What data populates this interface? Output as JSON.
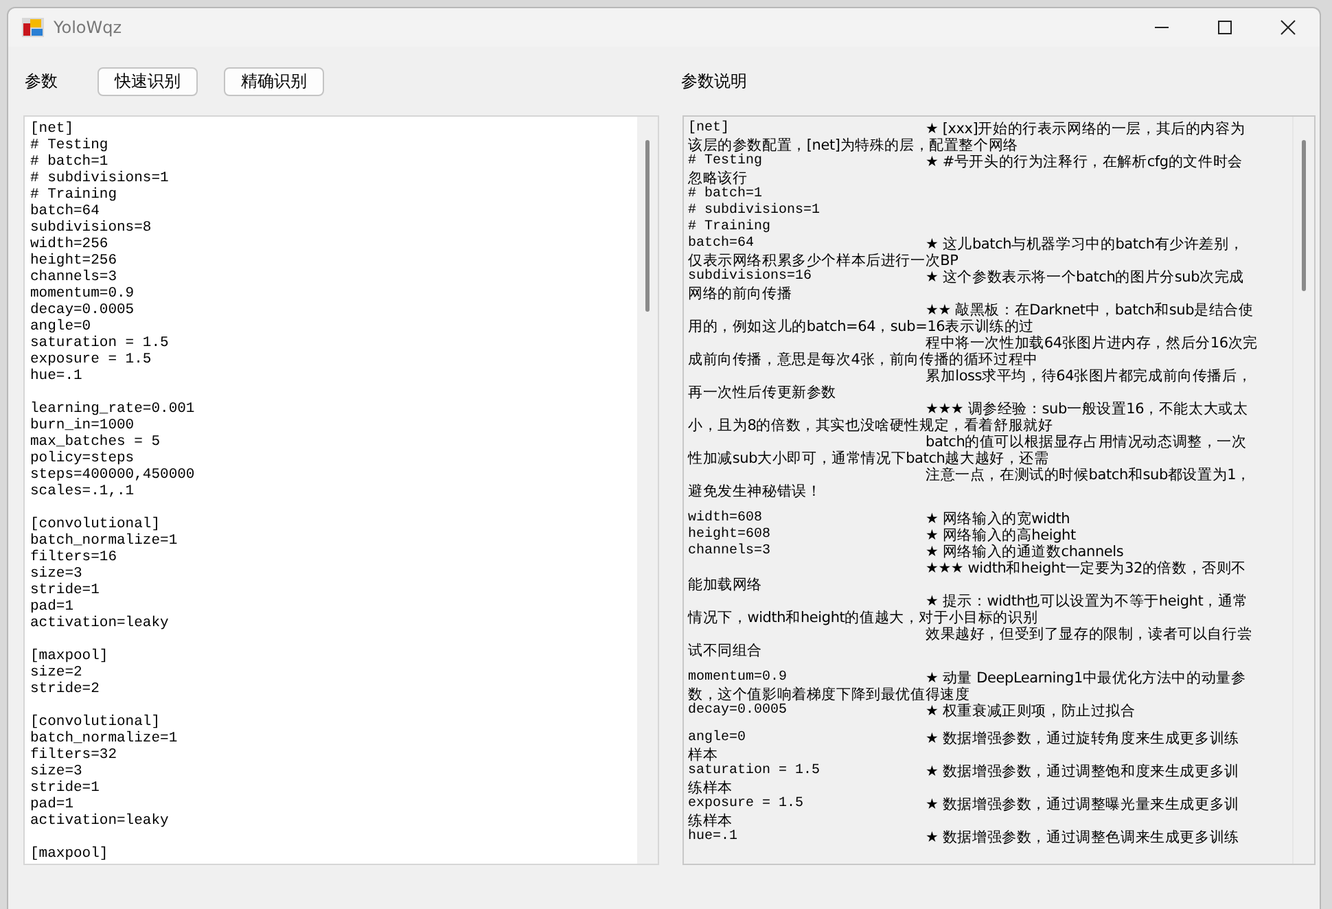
{
  "window": {
    "title": "YoloWqz"
  },
  "toolbar": {
    "params_label": "参数",
    "buttons": [
      "快速识别",
      "精确识别"
    ],
    "notes_label": "参数说明"
  },
  "config_editor": {
    "blocks": [
      [
        "[net]",
        "# Testing",
        "# batch=1",
        "# subdivisions=1",
        "# Training",
        "batch=64",
        "subdivisions=8",
        "width=256",
        "height=256",
        "channels=3",
        "momentum=0.9",
        "decay=0.0005",
        "angle=0",
        "saturation = 1.5",
        "exposure = 1.5",
        "hue=.1"
      ],
      [
        "learning_rate=0.001",
        "burn_in=1000",
        "max_batches = 5",
        "policy=steps",
        "steps=400000,450000",
        "scales=.1,.1"
      ],
      [
        "[convolutional]",
        "batch_normalize=1",
        "filters=16",
        "size=3",
        "stride=1",
        "pad=1",
        "activation=leaky"
      ],
      [
        "[maxpool]",
        "size=2",
        "stride=2"
      ],
      [
        "[convolutional]",
        "batch_normalize=1",
        "filters=32",
        "size=3",
        "stride=1",
        "pad=1",
        "activation=leaky"
      ],
      [
        "[maxpool]"
      ]
    ]
  },
  "notes_panel": {
    "blocks": [
      [
        {
          "code": "[net]",
          "note": "★ [xxx]开始的行表示网络的一层，其后的内容为",
          "continuation": "该层的参数配置，[net]为特殊的层，配置整个网络"
        },
        {
          "code": "# Testing",
          "note": "★ #号开头的行为注释行，在解析cfg的文件时会",
          "continuation": "忽略该行"
        },
        {
          "code": "# batch=1"
        },
        {
          "code": "# subdivisions=1"
        },
        {
          "code": "# Training"
        },
        {
          "code": "batch=64",
          "note": "★ 这儿batch与机器学习中的batch有少许差别，",
          "continuation": "仅表示网络积累多少个样本后进行一次BP"
        },
        {
          "code": "subdivisions=16",
          "note": "★ 这个参数表示将一个batch的图片分sub次完成",
          "continuation": "网络的前向传播"
        },
        {
          "note": "★★ 敲黑板：在Darknet中，batch和sub是结合使",
          "continuation": "用的，例如这儿的batch=64，sub=16表示训练的过"
        },
        {
          "note": "程中将一次性加载64张图片进内存，然后分16次完",
          "continuation": "成前向传播，意思是每次4张，前向传播的循环过程中"
        },
        {
          "note": "累加loss求平均，待64张图片都完成前向传播后，",
          "continuation": "再一次性后传更新参数"
        },
        {
          "note": "★★★ 调参经验：sub一般设置16，不能太大或太",
          "continuation": "小，且为8的倍数，其实也没啥硬性规定，看着舒服就好"
        },
        {
          "note": "batch的值可以根据显存占用情况动态调整，一次",
          "continuation": "性加减sub大小即可，通常情况下batch越大越好，还需"
        },
        {
          "note": "注意一点，在测试的时候batch和sub都设置为1，",
          "continuation": "避免发生神秘错误！"
        }
      ],
      [
        {
          "code": "width=608",
          "note": "★ 网络输入的宽width"
        },
        {
          "code": "height=608",
          "note": "★ 网络输入的高height"
        },
        {
          "code": "channels=3",
          "note": "★ 网络输入的通道数channels"
        },
        {
          "note": "★★★ width和height一定要为32的倍数，否则不",
          "continuation": "能加载网络"
        },
        {
          "note": "★ 提示：width也可以设置为不等于height，通常",
          "continuation": "情况下，width和height的值越大，对于小目标的识别"
        },
        {
          "note": "效果越好，但受到了显存的限制，读者可以自行尝",
          "continuation": "试不同组合"
        }
      ],
      [
        {
          "code": "momentum=0.9",
          "note": "★ 动量 DeepLearning1中最优化方法中的动量参",
          "continuation": "数，这个值影响着梯度下降到最优值得速度"
        },
        {
          "code": "decay=0.0005",
          "note": "★ 权重衰减正则项，防止过拟合"
        }
      ],
      [
        {
          "code": "angle=0",
          "note": "★ 数据增强参数，通过旋转角度来生成更多训练",
          "continuation": "样本"
        },
        {
          "code": "saturation = 1.5",
          "note": "★ 数据增强参数，通过调整饱和度来生成更多训",
          "continuation": "练样本"
        },
        {
          "code": "exposure = 1.5",
          "note": "★ 数据增强参数，通过调整曝光量来生成更多训",
          "continuation": "练样本"
        },
        {
          "code": "hue=.1",
          "note": "★ 数据增强参数，通过调整色调来生成更多训练"
        }
      ]
    ]
  }
}
